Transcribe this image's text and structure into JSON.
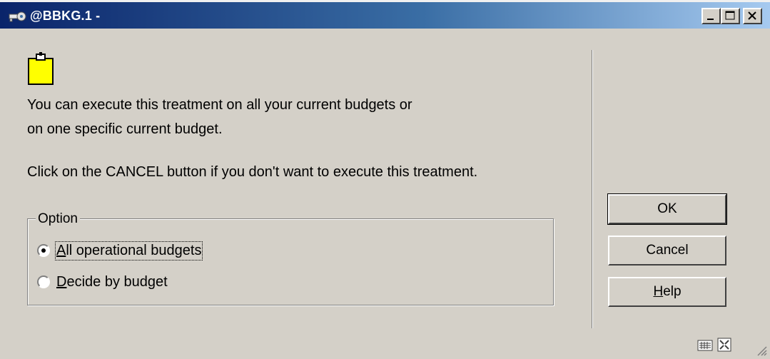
{
  "window": {
    "title": "@BBKG.1 -",
    "minimize_label": "minimize",
    "maximize_label": "maximize",
    "close_label": "close"
  },
  "message": {
    "line1": "You can execute this treatment on all your current budgets or",
    "line2": "on one specific current budget.",
    "line3": "Click on the CANCEL button if you don't want to execute this treatment."
  },
  "option_group": {
    "legend": "Option",
    "options": [
      {
        "label": "All operational budgets",
        "accel": "A",
        "rest": "ll operational budgets",
        "selected": true
      },
      {
        "label": "Decide by budget",
        "accel": "D",
        "rest": "ecide by budget",
        "selected": false
      }
    ]
  },
  "buttons": {
    "ok": "OK",
    "cancel": "Cancel",
    "help_accel": "H",
    "help_rest": "elp"
  },
  "colors": {
    "titlebar_start": "#0a246a",
    "titlebar_end": "#a6caf0",
    "dialog_bg": "#d4d0c8",
    "doc_icon": "#ffff00"
  },
  "icons": {
    "app": "key-icon",
    "document": "clipboard-icon",
    "status1": "keyboard-icon",
    "status2": "resize-icon"
  }
}
